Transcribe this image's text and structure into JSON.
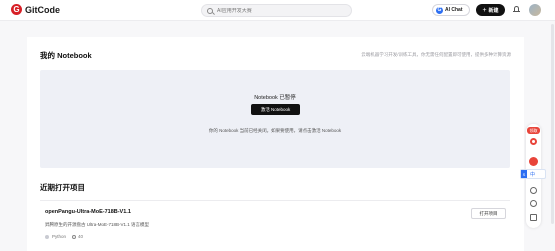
{
  "header": {
    "logo_text": "GitCode",
    "search_placeholder": "AI应用开发大赛",
    "chat_label": "AI Chat",
    "new_label": "新建",
    "icons": [
      "gitcode-logo-icon",
      "search-icon",
      "bell-icon",
      "avatar"
    ]
  },
  "main": {
    "title": "我的 Notebook",
    "description": "云端机器学习开发/训练工具，你无需任何配置即可使用，提供多种计算资源",
    "status": {
      "title": "Notebook 已暂停",
      "button": "激活 Notebook",
      "hint": "你的 Notebook 当前已经关闭。如果要使用，请点击激活 Notebook"
    },
    "recent": {
      "title": "近期打开项目",
      "projects": [
        {
          "name": "openPangu-Ultra-MoE-718B-V1.1",
          "desc": "昇腾原生的开源盘古 Ultra-MoE-718B-V1.1 语言模型",
          "language": "Python",
          "stars": "40",
          "open_label": "打开项目"
        }
      ]
    }
  },
  "float_bar": {
    "badge": "领取",
    "lang_short": "S",
    "lang_label": "中"
  },
  "colors": {
    "brand": "#d71f26",
    "panel": "#eef0f6",
    "primary_button": "#111111",
    "accent_blue": "#2d6ff2"
  }
}
